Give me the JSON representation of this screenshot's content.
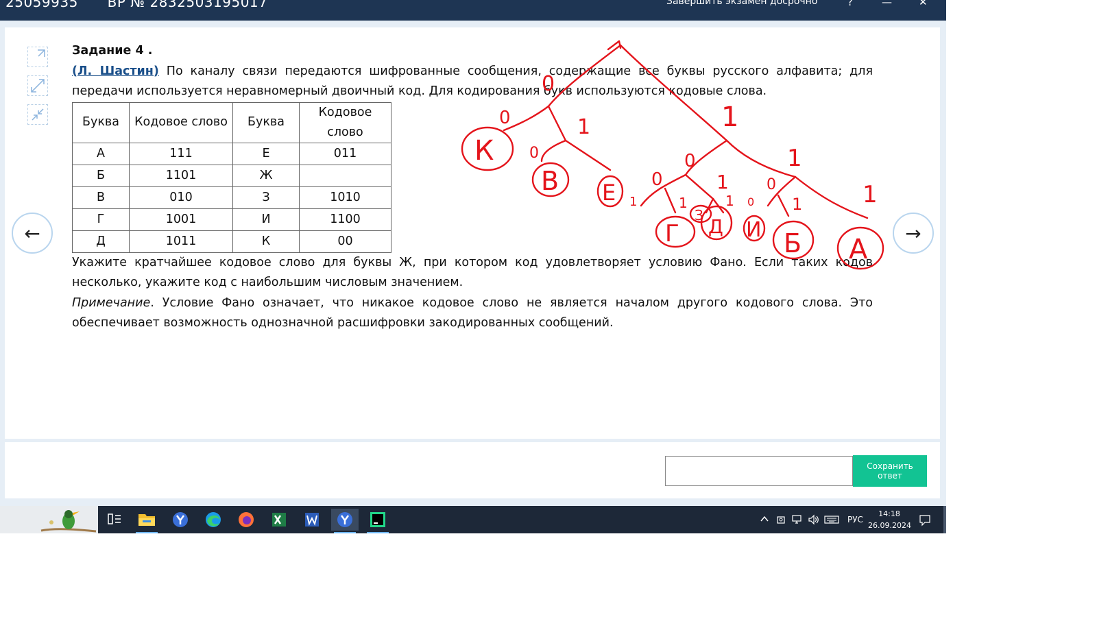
{
  "window": {
    "id_number": "25059935",
    "variant": "ВР № 2832503195017",
    "finish_exam": "Завершить экзамен досрочно",
    "help": "?",
    "minimize": "—",
    "close": "✕"
  },
  "task": {
    "title": "Задание 4 .",
    "author": "(Л. Шастин)",
    "intro_text": " По каналу связи передаются шифрованные сообщения, содержащие все буквы русского алфавита; для передачи используется неравномерный двоичный код. Для кодирования букв используются кодовые слова.",
    "table": {
      "headers": [
        "Буква",
        "Кодовое слово",
        "Буква",
        "Кодовое слово"
      ],
      "rows": [
        [
          "А",
          "111",
          "Е",
          "011"
        ],
        [
          "Б",
          "1101",
          "Ж",
          ""
        ],
        [
          "В",
          "010",
          "З",
          "1010"
        ],
        [
          "Г",
          "1001",
          "И",
          "1100"
        ],
        [
          "Д",
          "1011",
          "К",
          "00"
        ]
      ]
    },
    "question": "Укажите кратчайшее кодовое слово для буквы Ж, при котором код удовлетворяет условию Фано. Если таких кодов несколько, укажите код с наибольшим числовым значением.",
    "note_label": "Примечание",
    "note_text": ". Условие Фано означает, что никакое кодовое слово не является началом другого кодового слова. Это обеспечивает возможность однозначной расшифровки закодированных сообщений."
  },
  "navigation": {
    "prev": "←",
    "next": "→"
  },
  "answer": {
    "value": "",
    "save_label": "Сохранить ответ"
  },
  "annotation": {
    "color": "#e4141b",
    "labels": [
      "0",
      "0",
      "1",
      "К",
      "0",
      "1",
      "В",
      "Е",
      "0",
      "1",
      "0",
      "1",
      "0",
      "1",
      "1",
      "З",
      "1",
      "0",
      "1",
      "1",
      "Г",
      "Д",
      "И",
      "Б",
      "А"
    ]
  },
  "taskbar": {
    "language": "РУС",
    "time": "14:18",
    "date": "26.09.2024"
  }
}
